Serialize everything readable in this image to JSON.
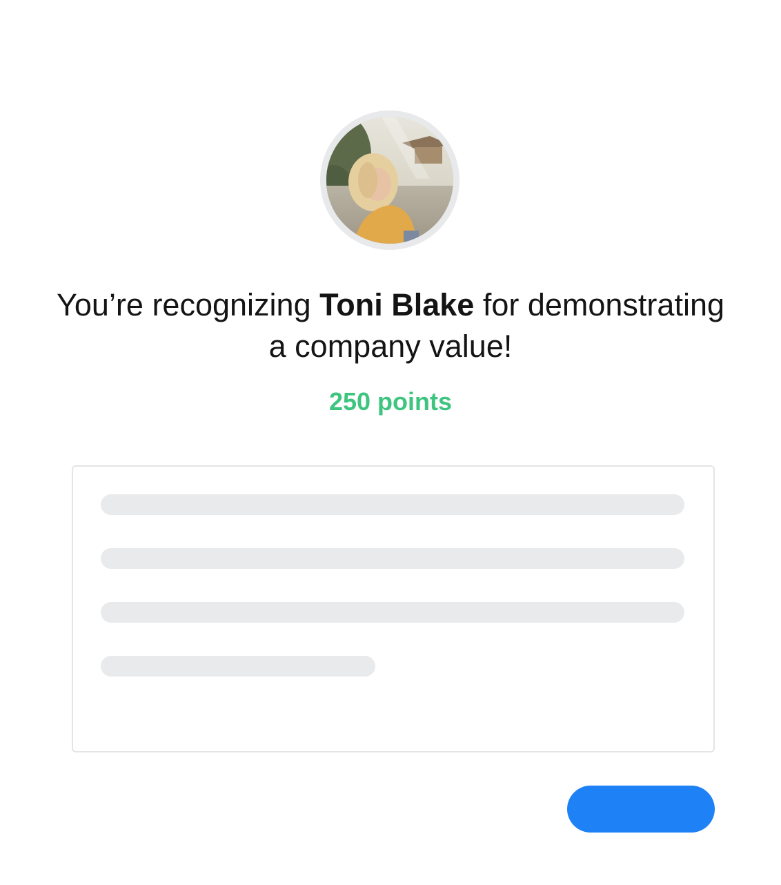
{
  "recipient": {
    "avatar": "avatar-photo",
    "name": "Toni Blake"
  },
  "headline": {
    "prefix": "You’re recognizing ",
    "name": "Toni Blake",
    "suffix": " for demonstrating a company value!"
  },
  "points": {
    "label": "250 points",
    "color": "#3dc47e"
  },
  "message": {
    "state": "loading-placeholder",
    "placeholder_line_count": 4
  },
  "submit_button": {
    "label": "",
    "color": "#1e82f6"
  }
}
